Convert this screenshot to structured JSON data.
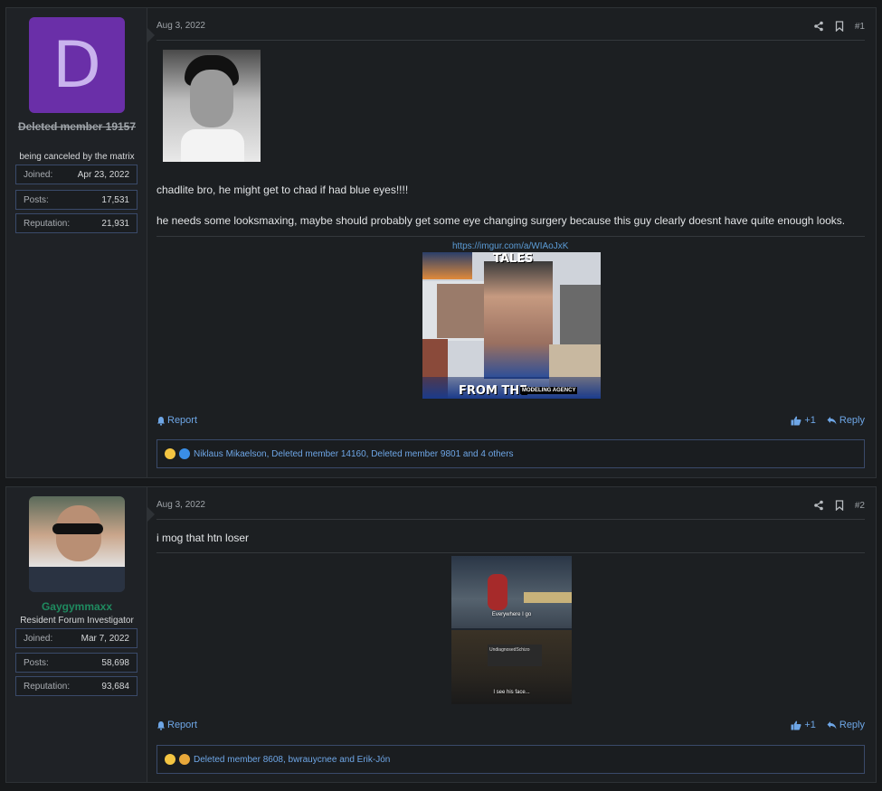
{
  "posts": [
    {
      "user": {
        "avatar_letter": "D",
        "name": "Deleted member 19157",
        "title": "being canceled by the matrix",
        "stats": [
          {
            "label": "Joined:",
            "value": "Apr 23, 2022"
          },
          {
            "label": "Posts:",
            "value": "17,531"
          },
          {
            "label": "Reputation:",
            "value": "21,931"
          }
        ]
      },
      "date": "Aug 3, 2022",
      "number": "#1",
      "text1": "chadlite bro, he might get to chad if had blue eyes!!!!",
      "text2": "he needs some looksmaxing, maybe should probably get some eye changing surgery because this guy clearly doesnt have quite enough looks.",
      "link": "https://imgur.com/a/WIAoJxK",
      "image_text_top": "TALES",
      "image_text_bottom": "FROM THE",
      "image_text_badge": "MODELING AGENCY",
      "report": "Report",
      "like": "+1",
      "reply": "Reply",
      "reactions": "Niklaus Mikaelson, Deleted member 14160, Deleted member 9801 and 4 others"
    },
    {
      "user": {
        "name": "Gaygymmaxx",
        "title": "Resident Forum Investigator",
        "stats": [
          {
            "label": "Joined:",
            "value": "Mar 7, 2022"
          },
          {
            "label": "Posts:",
            "value": "58,698"
          },
          {
            "label": "Reputation:",
            "value": "93,684"
          }
        ]
      },
      "date": "Aug 3, 2022",
      "number": "#2",
      "text1": "i mog that htn loser",
      "image_caption_top": "Everywhere I go",
      "image_caption_handle": "UndiagnosedSchizo",
      "image_caption_bottom": "I see his face...",
      "report": "Report",
      "like": "+1",
      "reply": "Reply",
      "reactions": "Deleted member 8608, bwrauycnee and Erik-Jón"
    }
  ],
  "colors": {
    "accent": "#6ea6e6",
    "avatar_purple": "#6a2fa8",
    "username_green": "#1f8a5f",
    "stat_border": "#3a4a6a"
  }
}
